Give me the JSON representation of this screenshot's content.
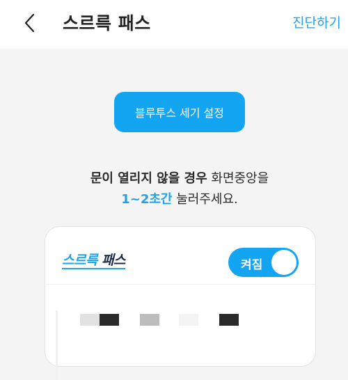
{
  "header": {
    "back_icon": "chevron-left-icon",
    "title": "스르륵 패스",
    "diagnose_label": "진단하기"
  },
  "main": {
    "bluetooth_button": "블루투스 세기 설정",
    "notice": {
      "line1_strong": "문이 열리지 않을 경우",
      "line1_rest": " 화면중앙을",
      "line2_accent": "1~2초간",
      "line2_rest": " 눌러주세요."
    }
  },
  "card": {
    "logo_part1": "스르륵",
    "logo_part2": " 패스",
    "toggle_label": "켜짐",
    "toggle_on": true
  },
  "colors": {
    "accent": "#13a5f2",
    "link": "#1ea2e8",
    "background": "#f4f4f4"
  }
}
